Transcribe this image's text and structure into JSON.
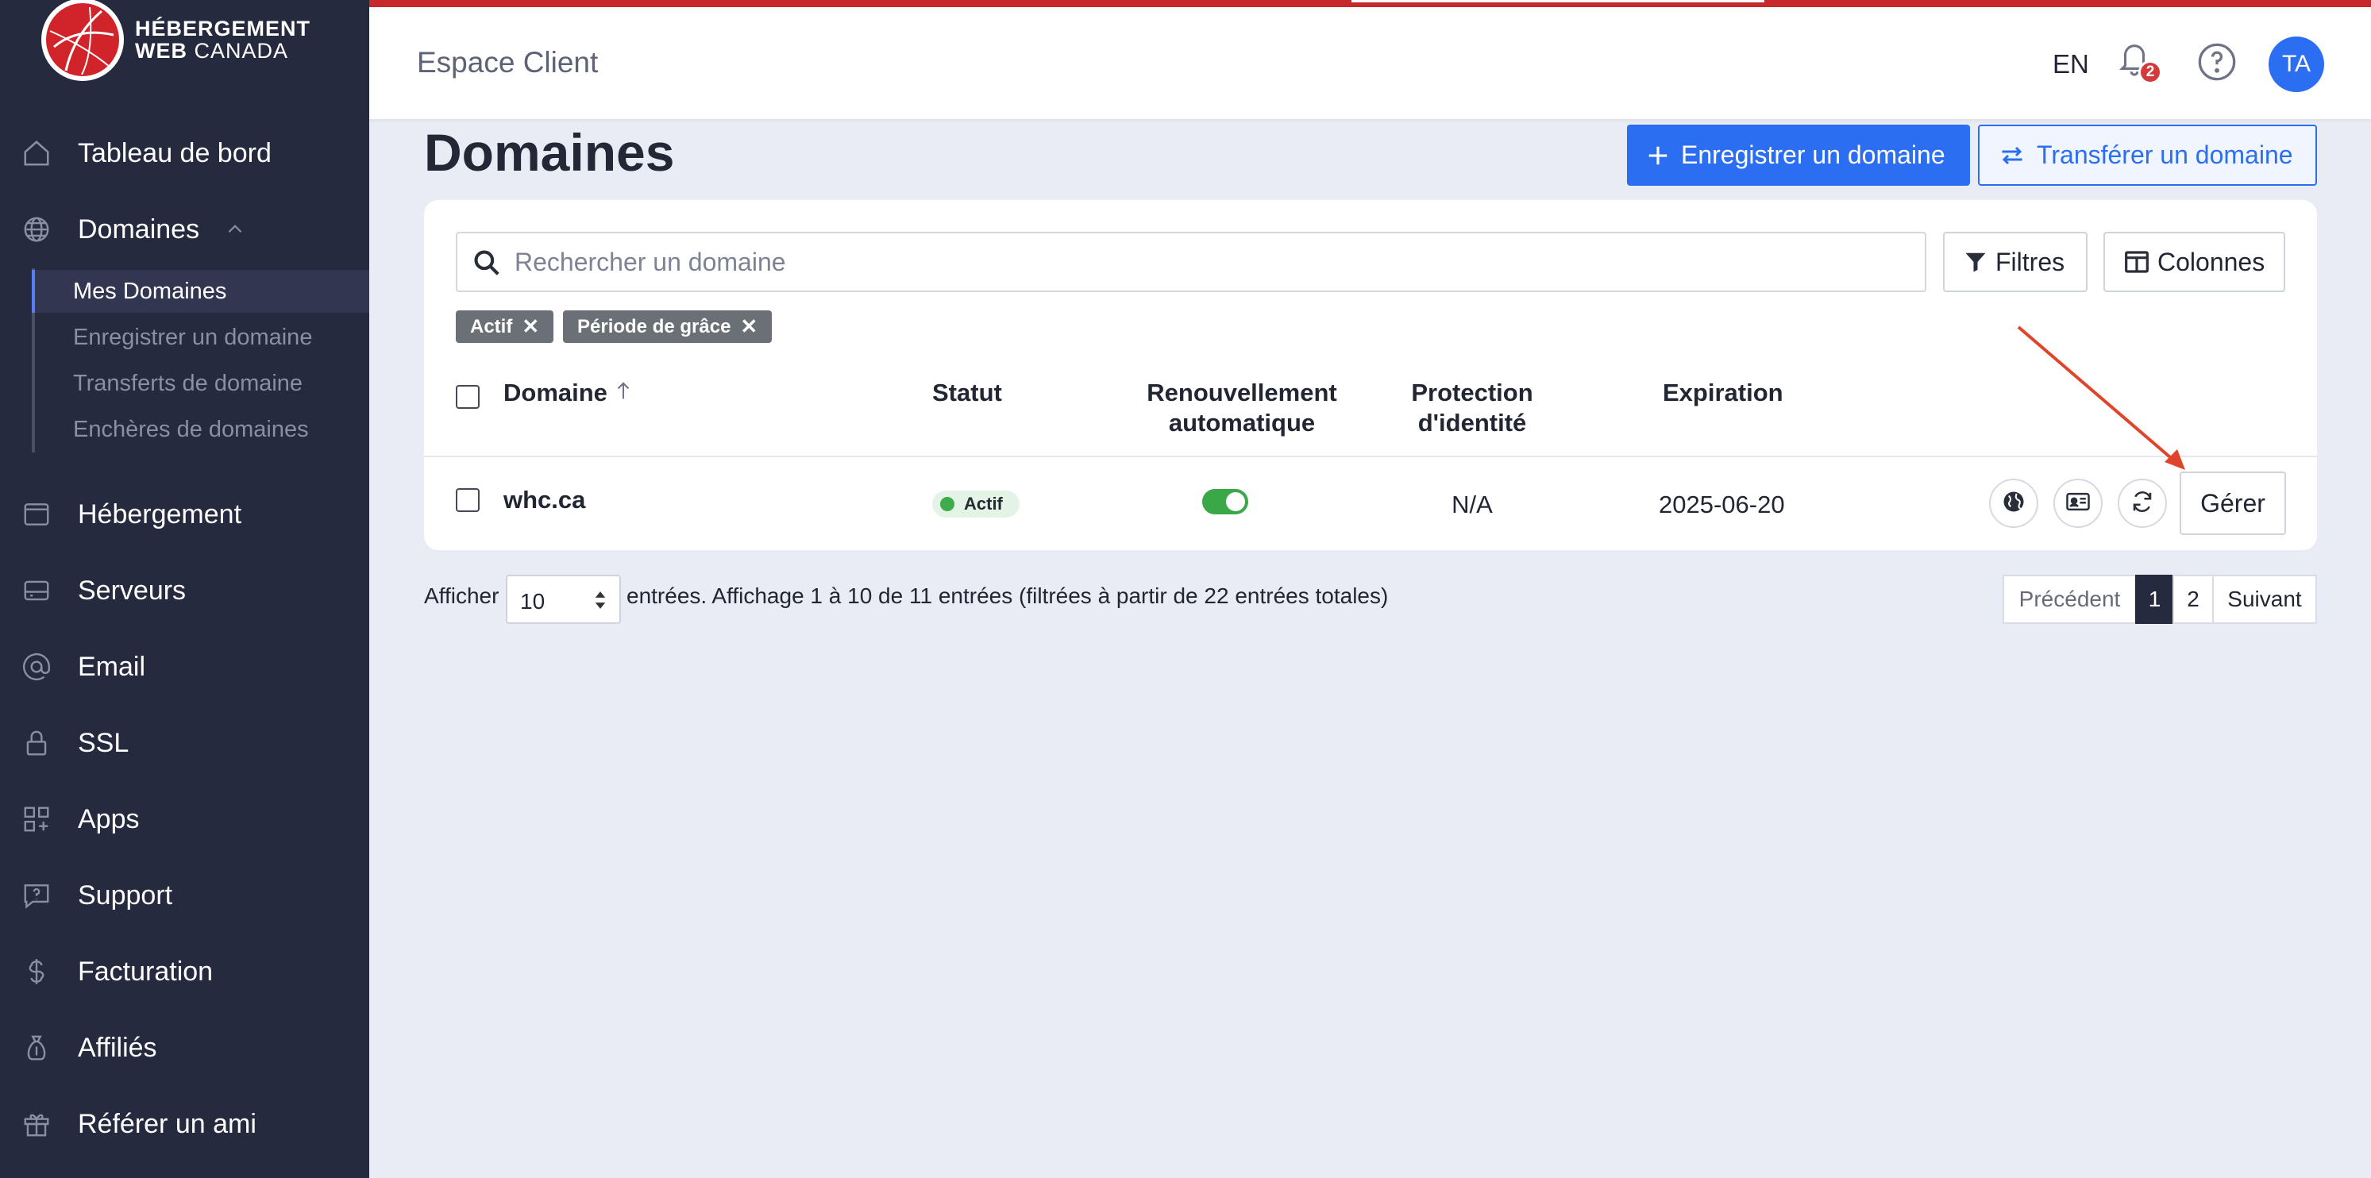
{
  "brand": {
    "line1": "HÉBERGEMENT",
    "line2_bold": "WEB",
    "line2_rest": " CANADA"
  },
  "sidebar": {
    "items": [
      {
        "label": "Tableau de bord",
        "icon": "home-icon"
      },
      {
        "label": "Domaines",
        "icon": "globe-icon"
      },
      {
        "label": "Hébergement",
        "icon": "browser-window-icon"
      },
      {
        "label": "Serveurs",
        "icon": "server-icon"
      },
      {
        "label": "Email",
        "icon": "at-sign-icon"
      },
      {
        "label": "SSL",
        "icon": "lock-icon"
      },
      {
        "label": "Apps",
        "icon": "apps-grid-icon"
      },
      {
        "label": "Support",
        "icon": "question-chat-icon"
      },
      {
        "label": "Facturation",
        "icon": "dollar-icon"
      },
      {
        "label": "Affiliés",
        "icon": "money-bag-icon"
      },
      {
        "label": "Référer un ami",
        "icon": "gift-icon"
      }
    ],
    "domain_subitems": [
      {
        "label": "Mes Domaines",
        "active": true
      },
      {
        "label": "Enregistrer un domaine"
      },
      {
        "label": "Transferts de domaine"
      },
      {
        "label": "Enchères de domaines"
      }
    ]
  },
  "header": {
    "title": "Espace Client",
    "language": "EN",
    "notifications_count": "2",
    "avatar_initials": "TA"
  },
  "page": {
    "title": "Domaines",
    "register_button": "Enregistrer un domaine",
    "transfer_button": "Transférer un domaine"
  },
  "toolbar": {
    "search_placeholder": "Rechercher un domaine",
    "filters_button": "Filtres",
    "columns_button": "Colonnes"
  },
  "active_filters": [
    "Actif",
    "Période de grâce"
  ],
  "table": {
    "columns": {
      "domain": "Domaine",
      "status": "Statut",
      "auto_renew_1": "Renouvellement",
      "auto_renew_2": "automatique",
      "privacy_1": "Protection",
      "privacy_2": "d'identité",
      "expiration": "Expiration"
    },
    "rows": [
      {
        "domain": "whc.ca",
        "status": "Actif",
        "auto_renew": true,
        "privacy": "N/A",
        "expiration": "2025-06-20",
        "manage_label": "Gérer"
      }
    ]
  },
  "pagination": {
    "show_label": "Afficher",
    "page_size": "10",
    "info": "entrées. Affichage 1 à 10 de 11 entrées (filtrées à partir de 22 entrées totales)",
    "previous": "Précédent",
    "pages": [
      "1",
      "2"
    ],
    "current_page": "1",
    "next": "Suivant"
  },
  "colors": {
    "sidebar_bg": "#262a3e",
    "accent": "#2b6ef2",
    "top_bar": "#c7282c",
    "status_green": "#3aa846",
    "annotation_arrow": "#e0452b"
  }
}
